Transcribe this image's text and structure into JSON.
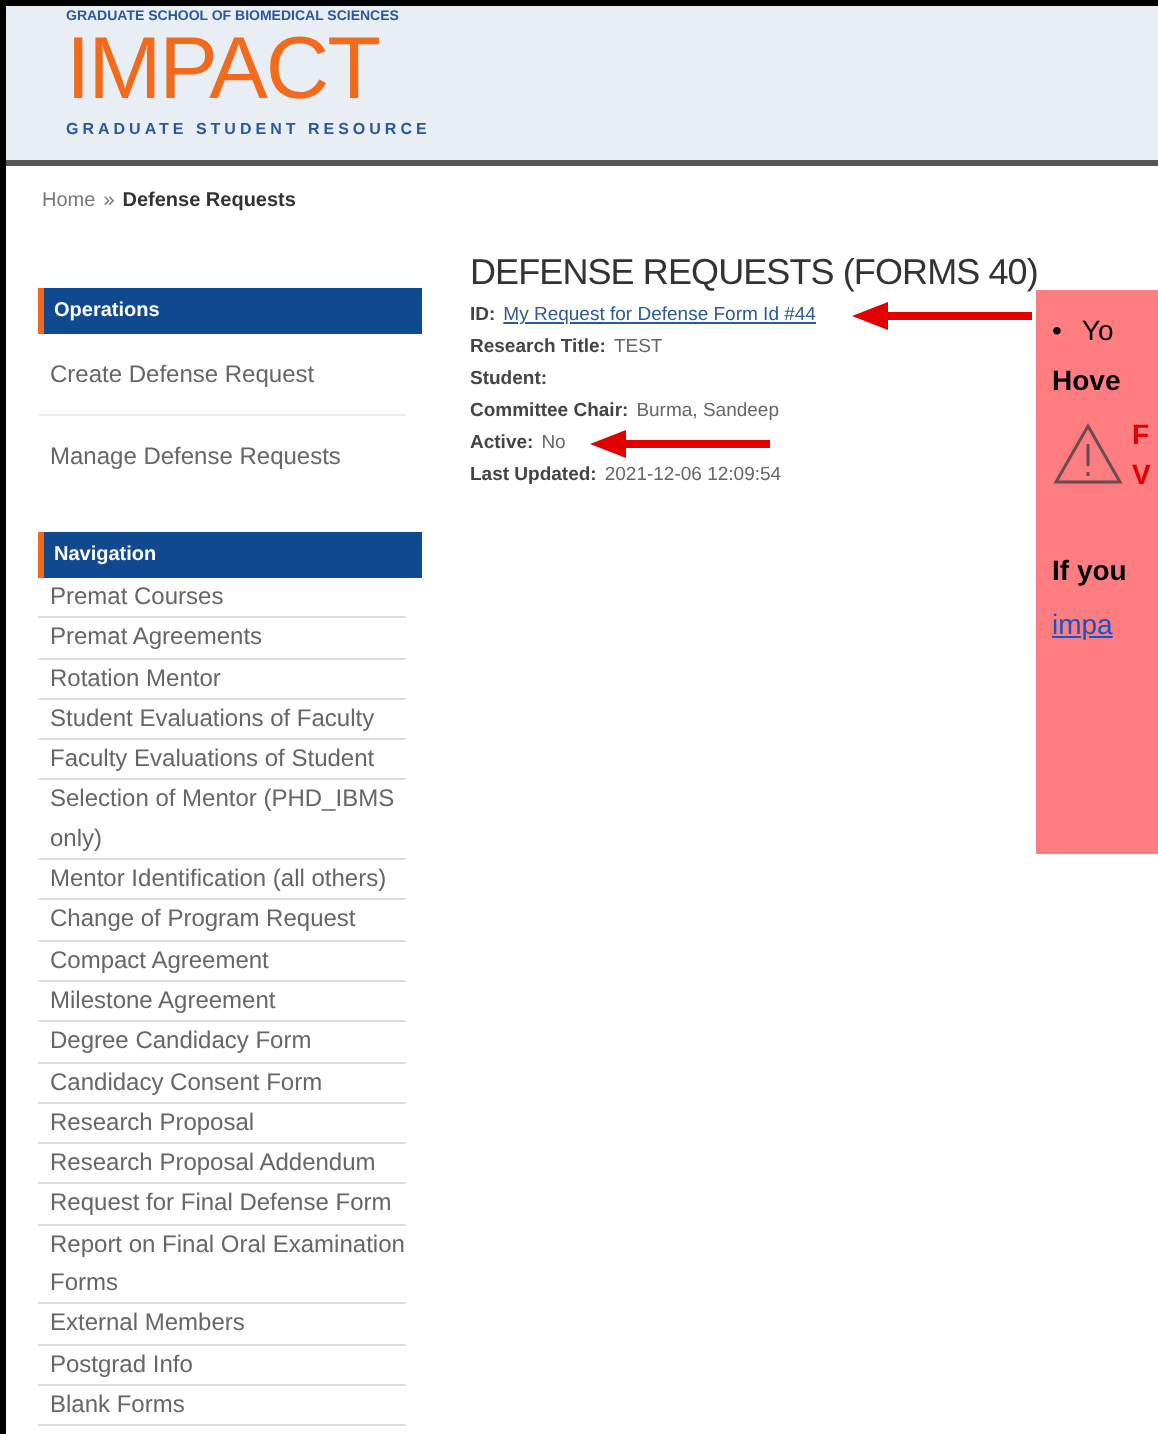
{
  "header": {
    "school": "GRADUATE SCHOOL OF BIOMEDICAL SCIENCES",
    "logo": "IMPACT",
    "tagline": "GRADUATE STUDENT RESOURCE"
  },
  "breadcrumb": {
    "home": "Home",
    "separator": "»",
    "current": "Defense Requests"
  },
  "sidebar": [
    {
      "title": "Operations",
      "kind": "spaced",
      "items": [
        "Create Defense Request",
        "Manage Defense Requests"
      ]
    },
    {
      "title": "Navigation",
      "kind": "compact",
      "items": [
        "Premat Courses",
        "Premat Agreements",
        "Rotation Mentor",
        "Student Evaluations of Faculty",
        "Faculty Evaluations of Student",
        "Selection of Mentor (PHD_IBMS only)",
        "Mentor Identification (all others)",
        "Change of Program Request",
        "Compact Agreement",
        "Milestone Agreement",
        "Degree Candidacy Form",
        "Candidacy Consent Form",
        "Research Proposal",
        "Research Proposal Addendum",
        "Request for Final Defense Form",
        "Report on Final Oral Examination Forms",
        "External Members",
        "Postgrad Info",
        "Blank Forms"
      ]
    }
  ],
  "content": {
    "title": "DEFENSE REQUESTS (FORMS 40)",
    "fields": [
      {
        "label": "ID:",
        "value": "My Request for Defense Form Id #44",
        "kind": "link"
      },
      {
        "label": "Research Title:",
        "value": "TEST",
        "kind": "text"
      },
      {
        "label": "Student:",
        "kind": "text"
      },
      {
        "label": "Committee Chair:",
        "value": "Burma, Sandeep",
        "kind": "text"
      },
      {
        "label": "Active:",
        "value": "No",
        "kind": "text"
      },
      {
        "label": "Last Updated:",
        "value": "2021-12-06 12:09:54",
        "kind": "text"
      }
    ]
  },
  "callout": {
    "bullet": "•",
    "line_1": "Yo",
    "line_2": "Hove",
    "warning_1": "F",
    "warning_2": "V",
    "line_3": "If you",
    "link": "impa"
  }
}
